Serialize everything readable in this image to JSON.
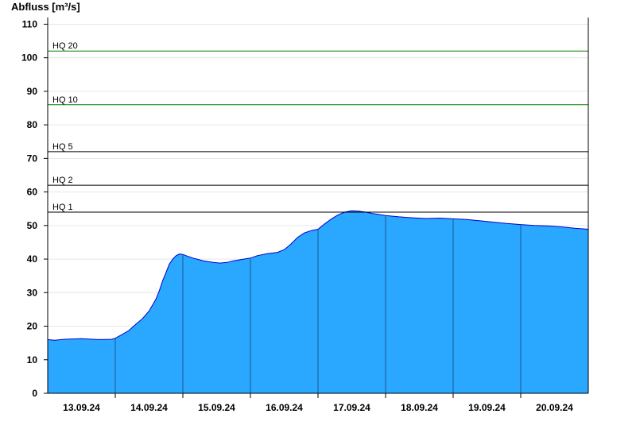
{
  "chart_data": {
    "type": "area",
    "ylabel": "Abfluss [m³/s]",
    "ylim": [
      0,
      112
    ],
    "yticks": [
      0,
      10,
      20,
      30,
      40,
      50,
      60,
      70,
      80,
      90,
      100,
      110
    ],
    "grid": true,
    "x_start": "12.09.24 12:00",
    "x_end": "20.09.24 24:00",
    "x_day_labels": [
      "13.09.24",
      "14.09.24",
      "15.09.24",
      "16.09.24",
      "17.09.24",
      "18.09.24",
      "19.09.24",
      "20.09.24"
    ],
    "reference_lines": [
      {
        "label": "HQ 20",
        "value": 102,
        "color": "#008000"
      },
      {
        "label": "HQ 10",
        "value": 86,
        "color": "#008000"
      },
      {
        "label": "HQ 5",
        "value": 72,
        "color": "#000000"
      },
      {
        "label": "HQ 2",
        "value": 62,
        "color": "#000000"
      },
      {
        "label": "HQ 1",
        "value": 54,
        "color": "#000000"
      }
    ],
    "series": [
      {
        "color": "#2aa7ff",
        "line_color": "#0000cc",
        "points": [
          [
            0.0,
            16.0
          ],
          [
            0.1,
            15.8
          ],
          [
            0.25,
            16.1
          ],
          [
            0.5,
            16.3
          ],
          [
            0.75,
            16.0
          ],
          [
            0.95,
            16.1
          ],
          [
            1.0,
            16.4
          ],
          [
            1.1,
            17.5
          ],
          [
            1.2,
            18.7
          ],
          [
            1.3,
            20.5
          ],
          [
            1.4,
            22.2
          ],
          [
            1.5,
            24.5
          ],
          [
            1.6,
            28.0
          ],
          [
            1.65,
            30.5
          ],
          [
            1.7,
            33.5
          ],
          [
            1.75,
            36.0
          ],
          [
            1.8,
            38.5
          ],
          [
            1.85,
            40.0
          ],
          [
            1.9,
            41.0
          ],
          [
            1.95,
            41.5
          ],
          [
            2.0,
            41.4
          ],
          [
            2.05,
            41.0
          ],
          [
            2.15,
            40.3
          ],
          [
            2.3,
            39.5
          ],
          [
            2.45,
            39.0
          ],
          [
            2.55,
            38.8
          ],
          [
            2.65,
            39.0
          ],
          [
            2.75,
            39.5
          ],
          [
            2.9,
            40.0
          ],
          [
            3.0,
            40.3
          ],
          [
            3.1,
            41.0
          ],
          [
            3.25,
            41.6
          ],
          [
            3.4,
            42.0
          ],
          [
            3.5,
            42.8
          ],
          [
            3.6,
            44.5
          ],
          [
            3.7,
            46.5
          ],
          [
            3.8,
            47.8
          ],
          [
            3.9,
            48.5
          ],
          [
            4.0,
            48.9
          ],
          [
            4.1,
            50.5
          ],
          [
            4.2,
            52.0
          ],
          [
            4.3,
            53.2
          ],
          [
            4.4,
            54.0
          ],
          [
            4.5,
            54.4
          ],
          [
            4.6,
            54.3
          ],
          [
            4.7,
            54.0
          ],
          [
            4.8,
            53.6
          ],
          [
            4.9,
            53.3
          ],
          [
            5.0,
            53.0
          ],
          [
            5.2,
            52.6
          ],
          [
            5.4,
            52.3
          ],
          [
            5.6,
            52.1
          ],
          [
            5.8,
            52.2
          ],
          [
            6.0,
            52.0
          ],
          [
            6.2,
            51.8
          ],
          [
            6.4,
            51.4
          ],
          [
            6.6,
            51.0
          ],
          [
            6.8,
            50.6
          ],
          [
            7.0,
            50.3
          ],
          [
            7.2,
            50.0
          ],
          [
            7.4,
            49.9
          ],
          [
            7.6,
            49.6
          ],
          [
            7.8,
            49.2
          ],
          [
            8.0,
            48.9
          ]
        ]
      }
    ]
  }
}
